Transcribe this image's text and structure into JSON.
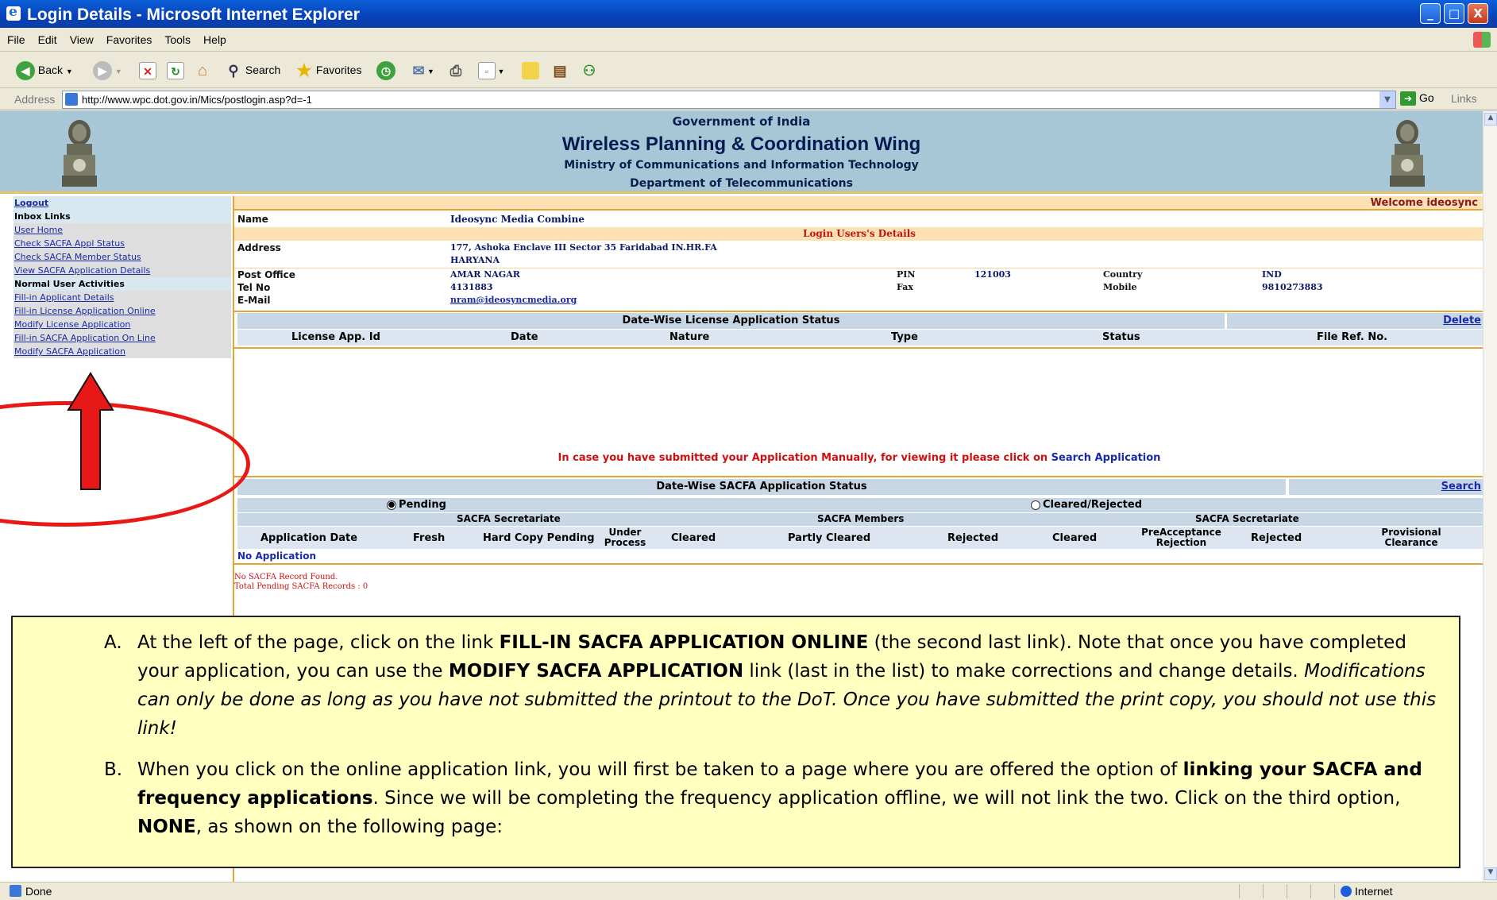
{
  "window": {
    "title": "Login Details - Microsoft Internet Explorer",
    "buttons": {
      "minimize": "_",
      "maximize": "□",
      "close": "X"
    }
  },
  "menu": [
    "File",
    "Edit",
    "View",
    "Favorites",
    "Tools",
    "Help"
  ],
  "toolbar": {
    "back": "Back",
    "search": "Search",
    "favorites": "Favorites"
  },
  "address": {
    "label": "Address",
    "url": "http://www.wpc.dot.gov.in/Mics/postlogin.asp?d=-1",
    "go": "Go",
    "links": "Links"
  },
  "banner": {
    "line1": "Government of India",
    "line2": "Wireless Planning & Coordination Wing",
    "line3": "Ministry of Communications and Information Technology",
    "line4": "Department of Telecommunications"
  },
  "sidebar": {
    "items": [
      "Logout",
      "Inbox Links",
      "User Home",
      "Check SACFA Appl Status",
      "Check SACFA Member Status",
      "View SACFA Application Details",
      "Normal User Activities",
      "Fill-in Applicant Details",
      "Fill-in License Application Online",
      "Modify License Application",
      "Fill-in SACFA Application On Line",
      "Modify SACFA Application"
    ]
  },
  "welcome": "Welcome ideosync",
  "user": {
    "name_label": "Name",
    "name": "Ideosync Media Combine",
    "section_title": "Login Users's Details",
    "address_label": "Address",
    "address1": "177, Ashoka Enclave III  Sector 35  Faridabad  IN.HR.FA",
    "address2": "HARYANA",
    "post_office_label": "Post Office",
    "post_office": "AMAR NAGAR",
    "pin_label": "PIN",
    "pin": "121003",
    "country_label": "Country",
    "country": "IND",
    "tel_label": "Tel No",
    "tel": "4131883",
    "fax_label": "Fax",
    "mobile_label": "Mobile",
    "mobile": "9810273883",
    "email_label": "E-Mail",
    "email": "nram@ideosyncmedia.org"
  },
  "license_status": {
    "title": "Date-Wise License Application Status",
    "delete": "Delete",
    "columns": [
      "License App. Id",
      "Date",
      "Nature",
      "Type",
      "Status",
      "File Ref. No."
    ]
  },
  "manual_note": {
    "text": "In case you have submitted your Application Manually, for viewing it please click on ",
    "link": "Search Application"
  },
  "sacfa_status": {
    "title": "Date-Wise SACFA Application Status",
    "search": "Search",
    "pending": "Pending",
    "cleared_rejected": "Cleared/Rejected",
    "group_secretariate": "SACFA Secretariate",
    "group_members": "SACFA Members",
    "group_secretariate2": "SACFA Secretariate",
    "columns": [
      "Application Date",
      "Fresh",
      "Hard Copy Pending",
      "Under Process",
      "Cleared",
      "Partly Cleared",
      "Rejected",
      "Cleared",
      "PreAcceptance Rejection",
      "Rejected",
      "Provisional Clearance"
    ],
    "no_app": "No Application",
    "no_record": "No SACFA Record Found.",
    "total_pending": "Total Pending SACFA Records : 0"
  },
  "note": {
    "a_marker": "A.",
    "a_1": "At the left of the page, click on the link ",
    "a_2": "FILL-IN SACFA APPLICATION ONLINE",
    "a_3": " (the second last link). Note that once you have completed your application, you can use the ",
    "a_4": "MODIFY SACFA APPLICATION",
    "a_5": " link (last in the list) to make corrections and change details. ",
    "a_6": "Modifications can only be done as long as you have not submitted the printout to the DoT. Once you have submitted the print copy, you should not use this link!",
    "b_marker": "B.",
    "b_1": "When you click on the online application link, you will first be taken to a page where you are offered the option of ",
    "b_2": "linking your SACFA and frequency applications",
    "b_3": ". Since we will be completing the frequency application offline, we will not link the two. Click on the third option, ",
    "b_4": "NONE",
    "b_5": ", as shown on the following page:"
  },
  "status": {
    "done": "Done",
    "zone": "Internet"
  },
  "colors": {
    "highlight": "#e81818",
    "banner": "#a7c6d6",
    "accent": "#e6a437"
  }
}
